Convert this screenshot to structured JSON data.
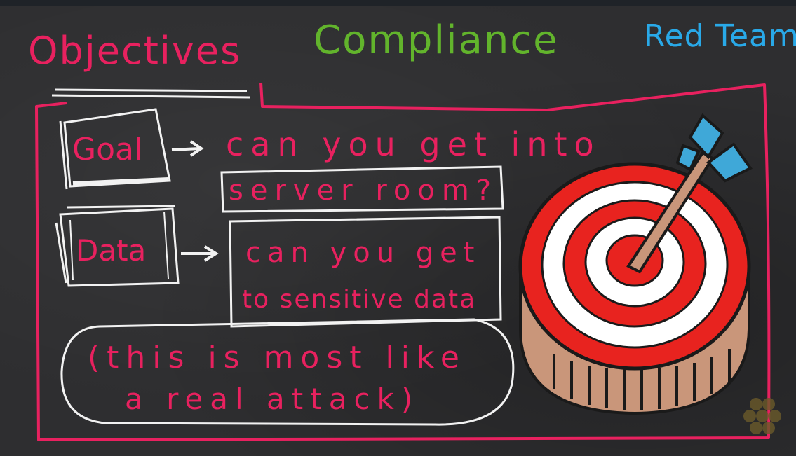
{
  "headings": {
    "objectives": "Objectives",
    "compliance": "Compliance",
    "red_team": "Red Team"
  },
  "goal": {
    "label": "Goal",
    "text_line1": "can you get into",
    "text_line2": "server room?"
  },
  "data": {
    "label": "Data",
    "text_line1": "can you get",
    "text_line2": "to sensitive data"
  },
  "note": {
    "line1": "(this is most like",
    "line2": "a real attack)"
  },
  "colors": {
    "board": "#2e2e30",
    "objectives": "#e8215f",
    "compliance": "#62b42c",
    "red_team": "#29a9e8",
    "chalk_white": "#f2f2f2",
    "target_red": "#e8231f",
    "target_white": "#ffffff",
    "target_base": "#c9967a"
  },
  "icons": [
    "target-arrow-icon",
    "udemy-watermark-icon"
  ]
}
